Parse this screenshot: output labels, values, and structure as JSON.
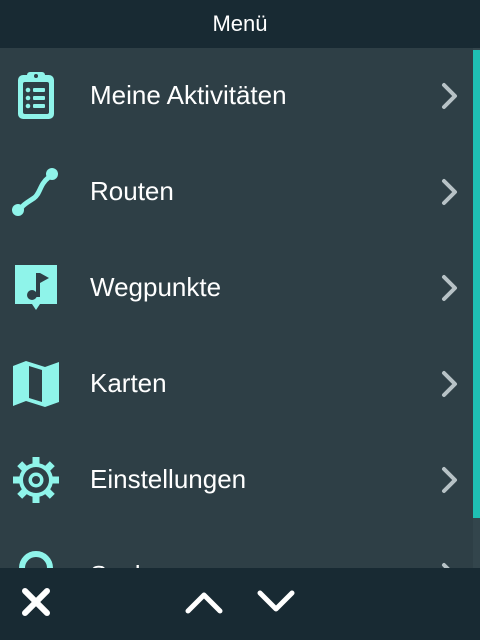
{
  "header": {
    "title": "Menü"
  },
  "colors": {
    "accent": "#8ff4ea",
    "header_bg": "#182a33",
    "list_bg": "#2e3f46",
    "scroll_thumb": "#1fbfb3",
    "chevron": "#b7c2c6"
  },
  "menu": {
    "items": [
      {
        "label": "Meine Aktivitäten",
        "icon": "clipboard-list-icon"
      },
      {
        "label": "Routen",
        "icon": "route-icon"
      },
      {
        "label": "Wegpunkte",
        "icon": "flag-marker-icon"
      },
      {
        "label": "Karten",
        "icon": "map-icon"
      },
      {
        "label": "Einstellungen",
        "icon": "gear-icon"
      },
      {
        "label": "Suchen",
        "icon": "search-icon"
      }
    ]
  },
  "footer": {
    "close_icon": "close-icon",
    "up_icon": "chevron-up-icon",
    "down_icon": "chevron-down-icon"
  }
}
